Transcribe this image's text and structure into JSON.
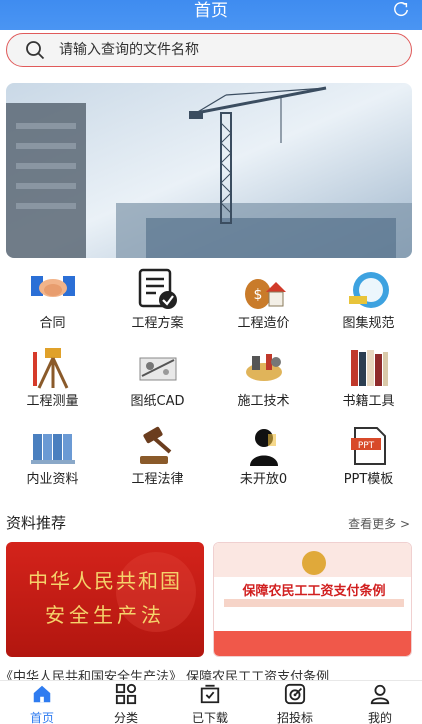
{
  "header": {
    "title": "首页"
  },
  "search": {
    "placeholder": "请输入查询的文件名称"
  },
  "grid": [
    {
      "label": "合同",
      "icon": "handshake-icon"
    },
    {
      "label": "工程方案",
      "icon": "document-check-icon"
    },
    {
      "label": "工程造价",
      "icon": "money-house-icon"
    },
    {
      "label": "图集规范",
      "icon": "standard-globe-icon"
    },
    {
      "label": "工程测量",
      "icon": "survey-tripod-icon"
    },
    {
      "label": "图纸CAD",
      "icon": "drawing-tools-icon"
    },
    {
      "label": "施工技术",
      "icon": "construction-tools-icon"
    },
    {
      "label": "书籍工具",
      "icon": "books-icon"
    },
    {
      "label": "内业资料",
      "icon": "file-binders-icon"
    },
    {
      "label": "工程法律",
      "icon": "gavel-icon"
    },
    {
      "label": "未开放0",
      "icon": "silhouette-icon"
    },
    {
      "label": "PPT模板",
      "icon": "ppt-icon"
    }
  ],
  "recommend": {
    "title": "资料推荐",
    "more": "查看更多 >",
    "card1": {
      "line1": "中华人民共和国",
      "line2": "安全生产法"
    },
    "card2": {
      "title": "保障农民工工资支付条例"
    },
    "captions": "《中华人民共和国安全生产法》  保障农民工工资支付条例"
  },
  "tabs": [
    {
      "label": "首页",
      "icon": "home-icon",
      "active": true
    },
    {
      "label": "分类",
      "icon": "category-icon",
      "active": false
    },
    {
      "label": "已下载",
      "icon": "downloaded-icon",
      "active": false
    },
    {
      "label": "招投标",
      "icon": "bidding-target-icon",
      "active": false
    },
    {
      "label": "我的",
      "icon": "user-icon",
      "active": false
    }
  ],
  "colors": {
    "primary": "#2f7cf0",
    "header": "#4a95f3",
    "search_border": "#e05a5a",
    "red": "#c8211a"
  }
}
